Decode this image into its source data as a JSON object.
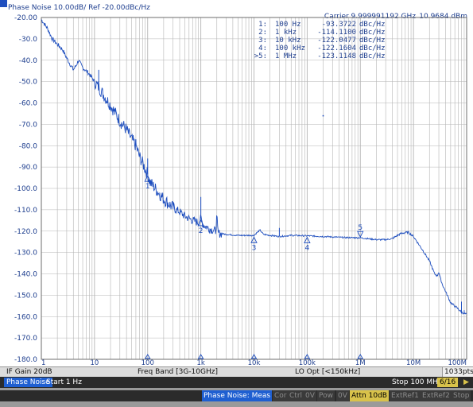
{
  "header": {
    "title": "Phase Noise 10.00dB/ Ref -20.00dBc/Hz",
    "carrier": "Carrier 9.999991192 GHz",
    "carrier_power": "10.9684 dBm"
  },
  "markers_table": [
    {
      "id": "1:",
      "freq": "100 Hz",
      "value": "-93.3722",
      "unit": "dBc/Hz"
    },
    {
      "id": "2:",
      "freq": "1 kHz",
      "value": "-114.1100",
      "unit": "dBc/Hz"
    },
    {
      "id": "3:",
      "freq": "10 kHz",
      "value": "-122.0477",
      "unit": "dBc/Hz"
    },
    {
      "id": "4:",
      "freq": "100 kHz",
      "value": "-122.1604",
      "unit": "dBc/Hz"
    },
    {
      "id": ">5:",
      "freq": "1 MHz",
      "value": "-123.1148",
      "unit": "dBc/Hz"
    }
  ],
  "status_bar": {
    "if_gain": "IF Gain 20dB",
    "freq_band": "Freq Band [3G-10GHz]",
    "lo_opt": "LO Opt [<150kHz]",
    "points": "1033pts"
  },
  "info_bar": {
    "mode": "Phase Noise",
    "start": "Start 1 Hz",
    "stop": "Stop 100 MHz",
    "page": "6/16"
  },
  "softkeys": [
    {
      "label": "Phase Noise: Meas",
      "state": "active"
    },
    {
      "label": "Cor",
      "state": "off"
    },
    {
      "label": "Ctrl",
      "state": "off"
    },
    {
      "label": "0V",
      "state": "off"
    },
    {
      "label": "Pow",
      "state": "off"
    },
    {
      "label": "0V",
      "state": "off"
    },
    {
      "label": "Attn 10dB",
      "state": "gold"
    },
    {
      "label": "ExtRef1",
      "state": "off"
    },
    {
      "label": "ExtRef2",
      "state": "off"
    },
    {
      "label": "Stop",
      "state": "off"
    }
  ],
  "colors": {
    "trace": "#1f4fbf",
    "grid": "#b4b4b4",
    "text": "#1f3f8f",
    "active": "#1f5fd1",
    "gold": "#d8c24a"
  },
  "chart_data": {
    "type": "line",
    "x_scale": "log",
    "xlim": [
      1,
      100000000
    ],
    "ylim": [
      -180,
      -20
    ],
    "x_tick_labels": [
      {
        "x": 1,
        "label": "1"
      },
      {
        "x": 10,
        "label": "10"
      },
      {
        "x": 100,
        "label": "100"
      },
      {
        "x": 1000,
        "label": "1k"
      },
      {
        "x": 10000,
        "label": "10k"
      },
      {
        "x": 100000,
        "label": "100k"
      },
      {
        "x": 1000000,
        "label": "1M"
      },
      {
        "x": 10000000,
        "label": "10M"
      },
      {
        "x": 100000000,
        "label": "100M"
      }
    ],
    "y_ticks": [
      -20,
      -30,
      -40,
      -50,
      -60,
      -70,
      -80,
      -90,
      -100,
      -110,
      -120,
      -130,
      -140,
      -150,
      -160,
      -170,
      -180
    ],
    "y_tick_labels": [
      "-20.00",
      "-30.0",
      "-40.0",
      "-50.0",
      "-60.0",
      "-70.0",
      "-80.0",
      "-90.0",
      "-100.0",
      "-110.0",
      "-120.0",
      "-130.0",
      "-140.0",
      "-150.0",
      "-160.0",
      "-170.0",
      "-180.0"
    ],
    "series": [
      {
        "x": [
          1,
          1.3,
          1.6,
          2,
          2.5,
          3,
          3.5,
          4,
          4.5,
          5,
          6,
          7,
          8,
          10,
          13,
          16,
          20,
          25,
          30,
          40,
          50,
          60,
          70,
          80,
          90,
          100,
          110,
          150,
          200,
          300,
          400,
          500,
          700,
          800,
          900,
          1000,
          1100,
          1500,
          1900,
          2000,
          2100,
          3000,
          5000,
          8000,
          10000,
          11000,
          13000,
          15000,
          20000,
          30000,
          50000,
          100000,
          200000,
          500000,
          1000000,
          2000000,
          3000000,
          4000000,
          5000000,
          6000000,
          8000000,
          10000000,
          15000000,
          20000000,
          25000000,
          28000000,
          30000000,
          32000000,
          35000000,
          50000000,
          70000000,
          80000000,
          100000000
        ],
        "y": [
          -21,
          -25,
          -30,
          -32.5,
          -35,
          -39,
          -42,
          -44.5,
          -42.5,
          -40,
          -43.5,
          -45,
          -46.5,
          -50,
          -54,
          -57.5,
          -61,
          -65,
          -68.5,
          -72.5,
          -77,
          -80,
          -85,
          -88,
          -91,
          -93.4,
          -97,
          -101,
          -105,
          -109,
          -111,
          -113,
          -115,
          -115.5,
          -116,
          -114.1,
          -117,
          -119,
          -120,
          -113,
          -121,
          -121.5,
          -122,
          -122,
          -122,
          -121,
          -119.5,
          -121.5,
          -122,
          -122.5,
          -122,
          -122.2,
          -122.5,
          -123,
          -123.1,
          -124,
          -124,
          -123.5,
          -122,
          -121,
          -120.5,
          -122.5,
          -129,
          -134,
          -140,
          -141,
          -139,
          -142,
          -145,
          -153.5,
          -156.5,
          -158,
          -159
        ]
      }
    ],
    "spikes": [
      {
        "x": 12,
        "y": -44.5
      },
      {
        "x": 60,
        "y": -77
      },
      {
        "x": 100,
        "y": -86
      },
      {
        "x": 1000,
        "y": -104
      },
      {
        "x": 2000,
        "y": -113
      },
      {
        "x": 30000,
        "y": -118.5
      },
      {
        "x": 80000000,
        "y": -153
      },
      {
        "x": 90000000,
        "y": -157
      }
    ],
    "markers": [
      {
        "label": "1",
        "x": 100,
        "y": -93.3722,
        "kind": "below"
      },
      {
        "label": "2",
        "x": 1000,
        "y": -114.11,
        "kind": "below"
      },
      {
        "label": "3",
        "x": 10000,
        "y": -122.0477,
        "kind": "below"
      },
      {
        "label": "4",
        "x": 100000,
        "y": -122.1604,
        "kind": "below"
      },
      {
        "label": "5",
        "x": 1000000,
        "y": -123.1148,
        "kind": "above"
      }
    ],
    "stray_point": {
      "x": 200000,
      "y": -66
    }
  }
}
